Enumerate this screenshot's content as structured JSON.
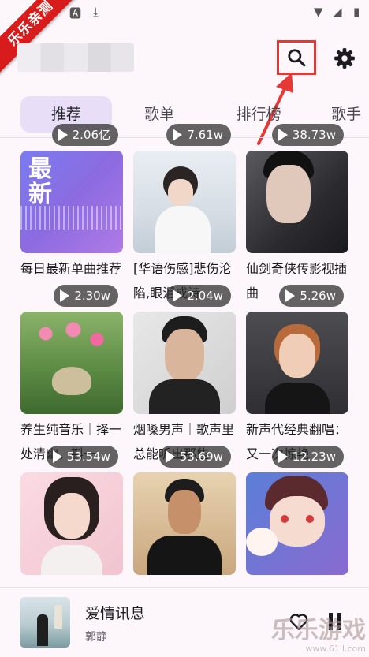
{
  "ribbon": "乐乐亲测",
  "tabs": [
    "推荐",
    "歌单",
    "排行榜",
    "歌手"
  ],
  "grid": [
    {
      "title": "每日最新单曲推荐",
      "plays": "2.06亿",
      "cover_text": "最新"
    },
    {
      "title": "[华语伤感]悲伤沦陷,眼泪成诗",
      "plays": "7.61w"
    },
    {
      "title": "仙剑奇侠传影视插曲",
      "plays": "38.73w"
    },
    {
      "title": "养生纯音乐｜择一处清幽，斟一",
      "plays": "2.30w"
    },
    {
      "title": "烟嗓男声｜歌声里总能听出那些",
      "plays": "2.04w"
    },
    {
      "title": "新声代经典翻唱：又一次惊艳",
      "plays": "5.26w"
    },
    {
      "title": "",
      "plays": "53.54w"
    },
    {
      "title": "",
      "plays": "53.69w"
    },
    {
      "title": "",
      "plays": "12.23w"
    }
  ],
  "player": {
    "title": "爱情讯息",
    "artist": "郭静"
  },
  "watermark": {
    "main": "乐乐游戏",
    "sub": "www.61ll.com"
  }
}
